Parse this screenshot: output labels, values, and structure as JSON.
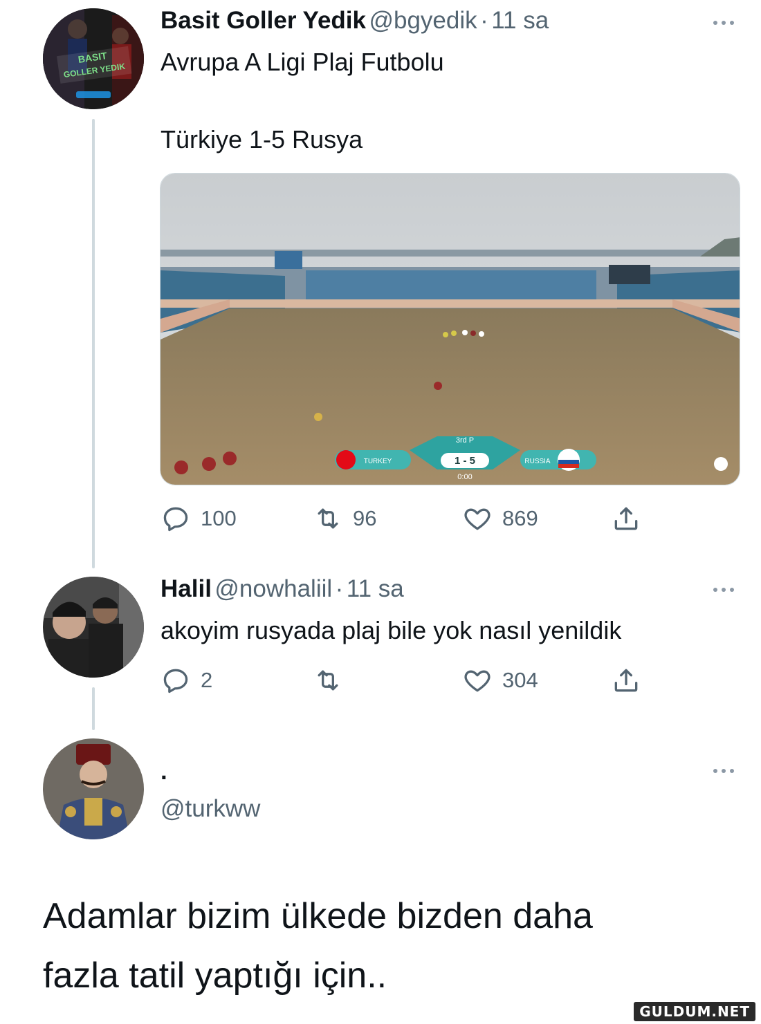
{
  "tweet1": {
    "author_name": "Basit Goller Yedik",
    "author_handle": "@bgyedik",
    "separator": "·",
    "time": "11 sa",
    "text_line1": "Avrupa A Ligi Plaj Futbolu",
    "text_line2": "Türkiye 1-5 Rusya",
    "avatar_logo_line1": "BASIT",
    "avatar_logo_line2": "GOLLER YEDIK",
    "media": {
      "scoreboard": {
        "period": "3rd P",
        "team_home": "TURKEY",
        "team_away": "RUSSIA",
        "score": "1 - 5",
        "clock": "0:00"
      }
    },
    "replies": "100",
    "retweets": "96",
    "likes": "869"
  },
  "tweet2": {
    "author_name": "Halil",
    "author_handle": "@nowhaliil",
    "separator": "·",
    "time": "11 sa",
    "text": "akoyim rusyada plaj bile yok nasıl yenildik",
    "replies": "2",
    "retweets": "",
    "likes": "304"
  },
  "tweet3": {
    "author_name": ".",
    "author_handle": "@turkww",
    "text_line1": "Adamlar bizim ülkede bizden daha",
    "text_line2": "fazla tatil yaptığı için.."
  },
  "watermark": "GULDUM.NET",
  "icons": {
    "reply": "reply-icon",
    "retweet": "retweet-icon",
    "like": "heart-icon",
    "share": "share-icon",
    "more": "more-icon"
  }
}
